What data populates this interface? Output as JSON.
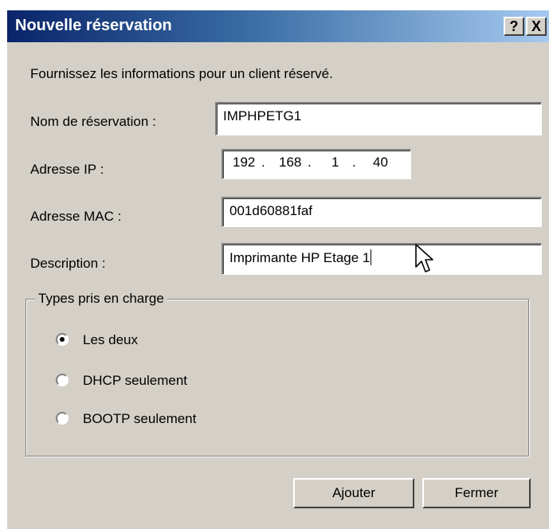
{
  "window": {
    "title": "Nouvelle réservation",
    "help_label": "?",
    "close_label": "X"
  },
  "intro": "Fournissez les informations pour un client réservé.",
  "form": {
    "name_label": "Nom de réservation :",
    "name_value": "IMPHPETG1",
    "ip_label": "Adresse IP :",
    "ip_octets": [
      "192",
      "168",
      "1",
      "40"
    ],
    "mac_label": "Adresse MAC :",
    "mac_value": "001d60881faf",
    "desc_label": "Description :",
    "desc_value": "Imprimante HP Etage 1"
  },
  "types": {
    "legend": "Types pris en charge",
    "options": [
      {
        "label": "Les deux",
        "checked": true
      },
      {
        "label": "DHCP seulement",
        "checked": false
      },
      {
        "label": "BOOTP seulement",
        "checked": false
      }
    ]
  },
  "buttons": {
    "add": "Ajouter",
    "close": "Fermer"
  },
  "icons": {
    "cursor": "mouse-pointer-icon"
  },
  "colors": {
    "titlebar_start": "#0a246a",
    "titlebar_end": "#a6caf0",
    "dialog_bg": "#d4d0c8"
  }
}
